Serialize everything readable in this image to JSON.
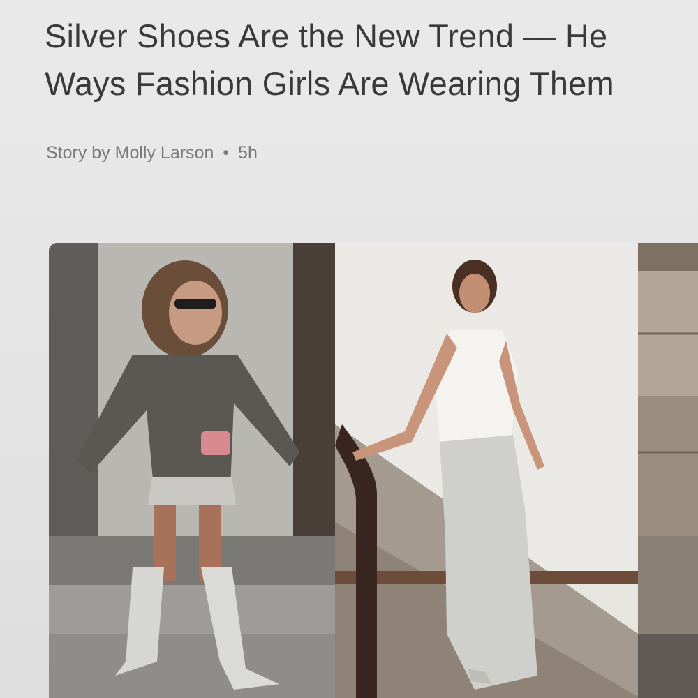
{
  "article": {
    "headline_line1": "Silver Shoes Are the New Trend — He",
    "headline_line2": "Ways Fashion Girls Are Wearing Them",
    "byline_author": "Story by Molly Larson",
    "byline_separator": "•",
    "byline_time": "5h"
  },
  "gallery": {
    "images": [
      {
        "name": "woman-in-grey-sweater-silver-boots"
      },
      {
        "name": "woman-in-white-tank-silver-skirt"
      },
      {
        "name": "partial-street-photo"
      }
    ]
  },
  "colors": {
    "page_bg": "#e6e6e6",
    "headline": "#3a3a3a",
    "byline": "#7a7a7a"
  }
}
